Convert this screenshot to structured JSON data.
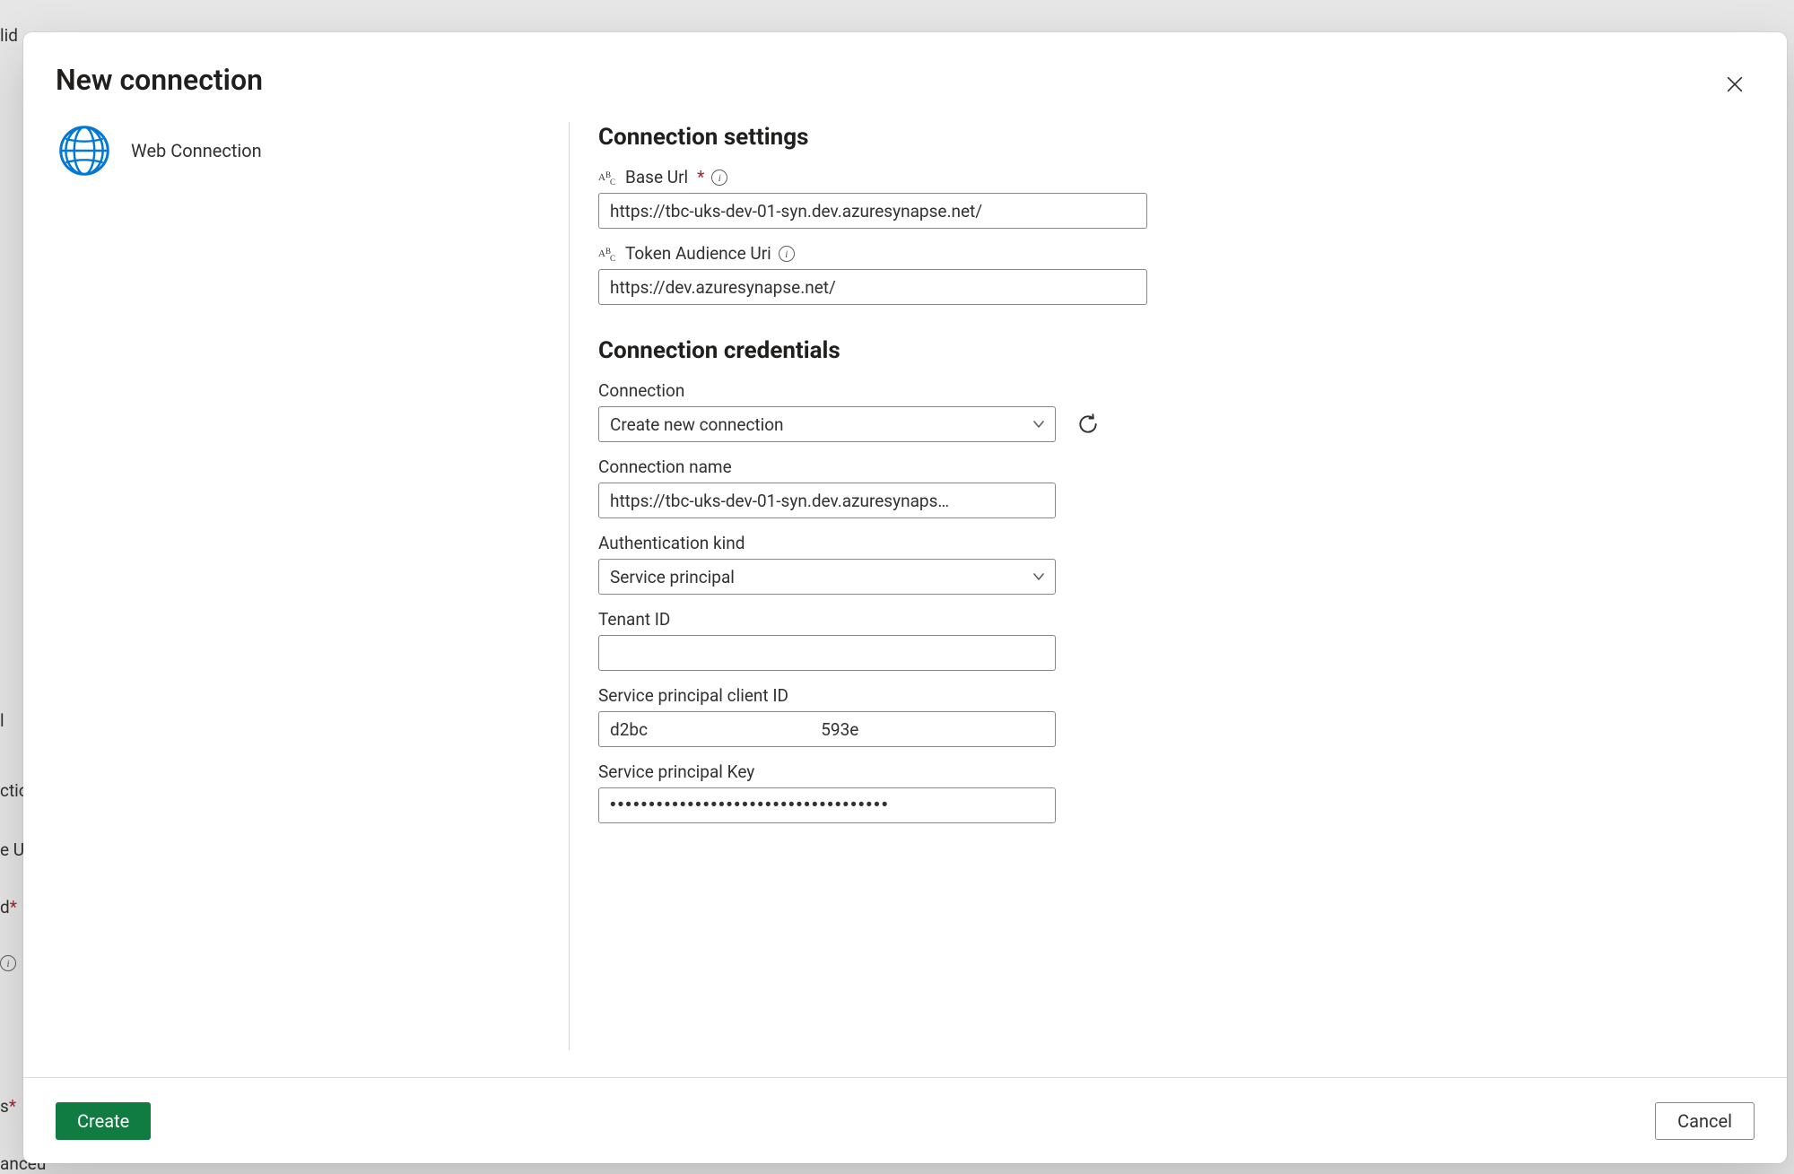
{
  "modal": {
    "title": "New connection",
    "connection_type_label": "Web Connection"
  },
  "sections": {
    "settings_title": "Connection settings",
    "credentials_title": "Connection credentials"
  },
  "fields": {
    "base_url": {
      "label": "Base Url",
      "required_marker": "*",
      "value": "https://tbc-uks-dev-01-syn.dev.azuresynapse.net/"
    },
    "token_audience_uri": {
      "label": "Token Audience Uri",
      "value": "https://dev.azuresynapse.net/"
    },
    "connection": {
      "label": "Connection",
      "value": "Create new connection"
    },
    "connection_name": {
      "label": "Connection name",
      "value": "https://tbc-uks-dev-01-syn.dev.azuresynaps…"
    },
    "auth_kind": {
      "label": "Authentication kind",
      "value": "Service principal"
    },
    "tenant_id": {
      "label": "Tenant ID",
      "value": ""
    },
    "sp_client_id": {
      "label": "Service principal client ID",
      "value": "d2bc                                         593e"
    },
    "sp_key": {
      "label": "Service principal Key",
      "value": "••••••••••••••••••••••••••••••••••••"
    }
  },
  "footer": {
    "create": "Create",
    "cancel": "Cancel"
  },
  "background_fragments": {
    "f1": "lid",
    "f2": "l",
    "f3": "ctio",
    "f4": "e U",
    "f5": "d *",
    "f6": "s *",
    "f7": "anceu"
  }
}
